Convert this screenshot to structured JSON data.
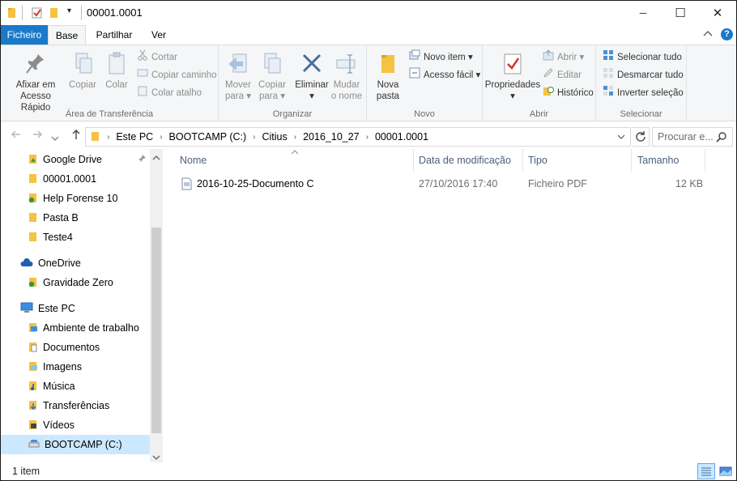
{
  "window": {
    "title": "00001.0001",
    "qa_dropdown": "▾",
    "minimize": "─",
    "maximize": "☐",
    "close": "✕"
  },
  "tabs": [
    {
      "label": "Ficheiro",
      "active": false,
      "accent": "#1979ca"
    },
    {
      "label": "Base",
      "active": true
    },
    {
      "label": "Partilhar",
      "active": false
    },
    {
      "label": "Ver",
      "active": false
    }
  ],
  "ribbon": {
    "groups": {
      "clipboard": "Área de Transferência",
      "organize": "Organizar",
      "new": "Novo",
      "open": "Abrir",
      "select": "Selecionar"
    },
    "pin": {
      "line1": "Afixar em",
      "line2": "Acesso Rápido"
    },
    "copy": "Copiar",
    "paste": "Colar",
    "cut": "Cortar",
    "copy_path": "Copiar caminho",
    "paste_shortcut": "Colar atalho",
    "move_to": {
      "line1": "Mover",
      "line2": "para ▾"
    },
    "copy_to": {
      "line1": "Copiar",
      "line2": "para ▾"
    },
    "delete": {
      "line1": "Eliminar",
      "line2": "▾"
    },
    "rename": {
      "line1": "Mudar",
      "line2": "o nome"
    },
    "new_folder": {
      "line1": "Nova",
      "line2": "pasta"
    },
    "new_item": "Novo item ▾",
    "easy_access": "Acesso fácil ▾",
    "properties": {
      "line1": "Propriedades",
      "line2": "▾"
    },
    "open": "Abrir ▾",
    "edit": "Editar",
    "history": "Histórico",
    "select_all": "Selecionar tudo",
    "select_none": "Desmarcar tudo",
    "invert": "Inverter seleção"
  },
  "address": {
    "crumbs": [
      "Este PC",
      "BOOTCAMP (C:)",
      "Citius",
      "2016_10_27",
      "00001.0001"
    ],
    "search_placeholder": "Procurar e..."
  },
  "nav": {
    "quick": [
      "Google Drive",
      "00001.0001",
      "Help Forense 10",
      "Pasta B",
      "Teste4"
    ],
    "onedrive": "OneDrive",
    "onedrive_items": [
      "Gravidade Zero"
    ],
    "thispc": "Este PC",
    "pc_items": [
      "Ambiente de trabalho",
      "Documentos",
      "Imagens",
      "Música",
      "Transferências",
      "Vídeos",
      "BOOTCAMP (C:)"
    ]
  },
  "columns": {
    "name": "Nome",
    "date": "Data de modificação",
    "type": "Tipo",
    "size": "Tamanho"
  },
  "files": [
    {
      "name": "2016-10-25-Documento C",
      "date": "27/10/2016 17:40",
      "type": "Ficheiro PDF",
      "size": "12 KB"
    }
  ],
  "status": {
    "count": "1 item"
  },
  "colors": {
    "accent": "#1979ca",
    "selected": "#cce8ff",
    "folder": "#f5c242"
  }
}
